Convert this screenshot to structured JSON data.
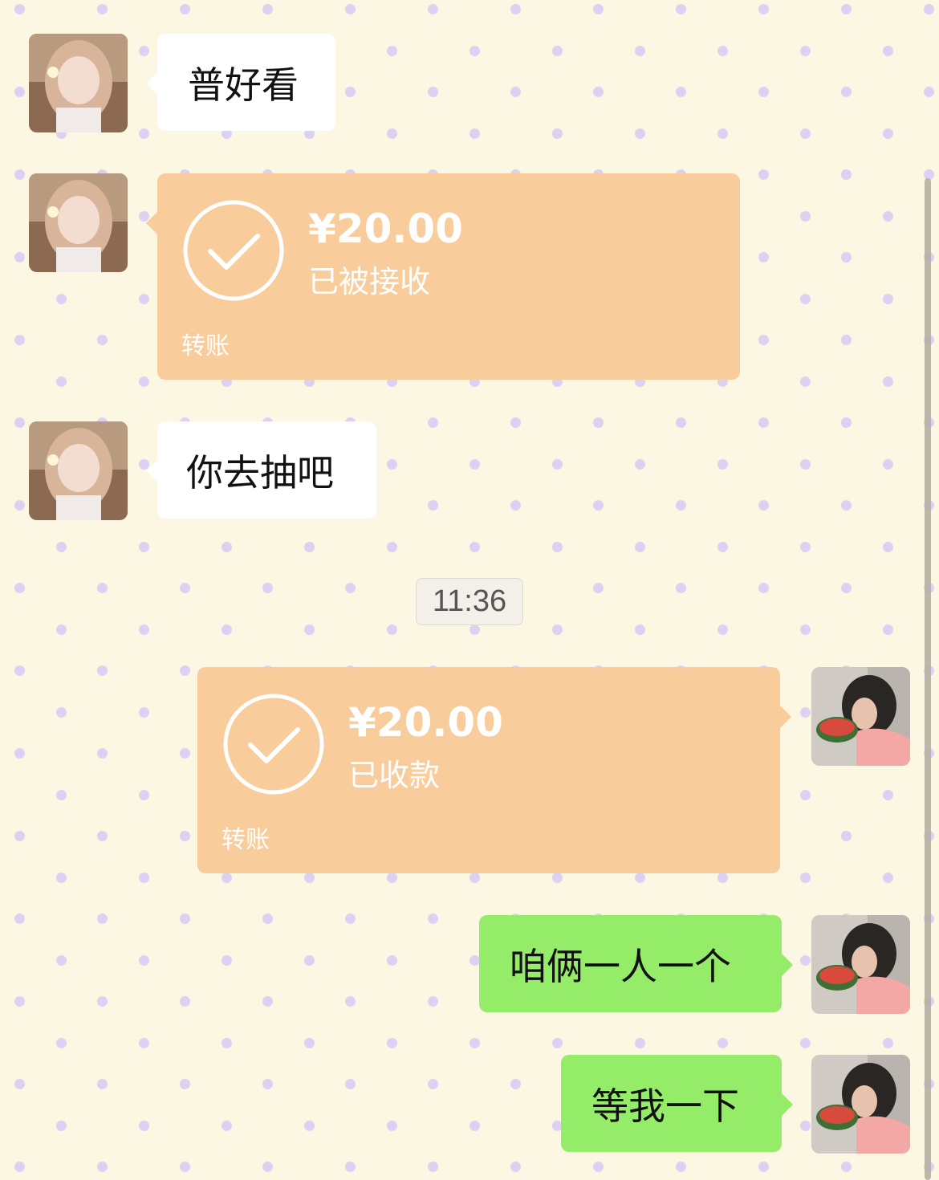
{
  "colors": {
    "background": "#fbf7e3",
    "dots": "#ddd0f2",
    "bubble_incoming": "#ffffff",
    "bubble_outgoing": "#95ec69",
    "transfer_card": "#f9cc9b"
  },
  "messages": {
    "m1": {
      "sender": "contact",
      "text": "普好看"
    },
    "m2": {
      "sender": "contact",
      "amount": "¥20.00",
      "status": "已被接收",
      "label": "转账",
      "icon": "check-circle-icon"
    },
    "m3": {
      "sender": "contact",
      "text": "你去抽吧"
    },
    "m4": {
      "sender": "me",
      "amount": "¥20.00",
      "status": "已收款",
      "label": "转账",
      "icon": "check-circle-icon"
    },
    "m5": {
      "sender": "me",
      "text": "咱俩一人一个"
    },
    "m6": {
      "sender": "me",
      "text": "等我一下"
    }
  },
  "timestamp": "11:36"
}
